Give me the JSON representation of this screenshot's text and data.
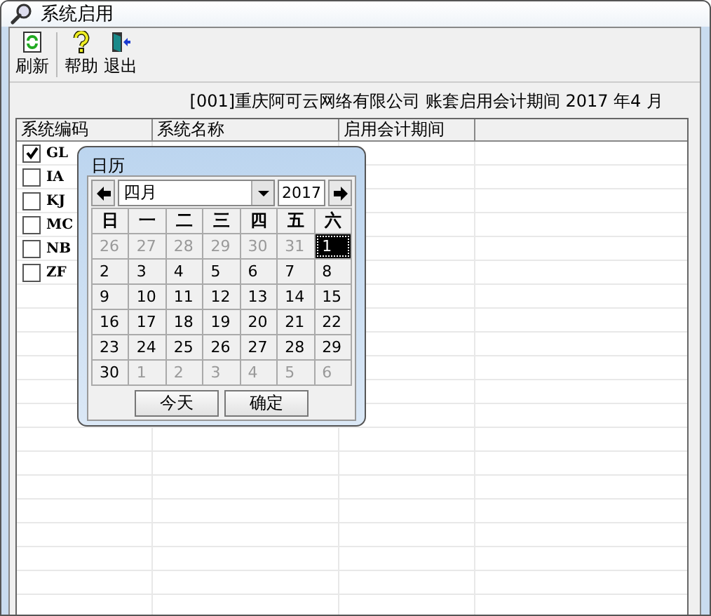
{
  "window": {
    "title": "系统启用"
  },
  "toolbar": [
    {
      "label": "刷新"
    },
    {
      "label": "帮助"
    },
    {
      "label": "退出"
    }
  ],
  "info": "[001]重庆阿可云网络有限公司 账套启用会计期间 2017 年4 月",
  "table": {
    "columns": [
      "系统编码",
      "系统名称",
      "启用会计期间"
    ],
    "rows": [
      {
        "code": "GL",
        "checked": true
      },
      {
        "code": "IA",
        "checked": false
      },
      {
        "code": "KJ",
        "checked": false
      },
      {
        "code": "MC",
        "checked": false
      },
      {
        "code": "NB",
        "checked": false
      },
      {
        "code": "ZF",
        "checked": false
      }
    ]
  },
  "calendar": {
    "title": "日历",
    "month": "四月",
    "year": "2017",
    "weekdays": [
      "日",
      "一",
      "二",
      "三",
      "四",
      "五",
      "六"
    ],
    "days": [
      {
        "label": "26",
        "current": false,
        "selected": false
      },
      {
        "label": "27",
        "current": false,
        "selected": false
      },
      {
        "label": "28",
        "current": false,
        "selected": false
      },
      {
        "label": "29",
        "current": false,
        "selected": false
      },
      {
        "label": "30",
        "current": false,
        "selected": false
      },
      {
        "label": "31",
        "current": false,
        "selected": false
      },
      {
        "label": "1",
        "current": true,
        "selected": true
      },
      {
        "label": "2",
        "current": true,
        "selected": false
      },
      {
        "label": "3",
        "current": true,
        "selected": false
      },
      {
        "label": "4",
        "current": true,
        "selected": false
      },
      {
        "label": "5",
        "current": true,
        "selected": false
      },
      {
        "label": "6",
        "current": true,
        "selected": false
      },
      {
        "label": "7",
        "current": true,
        "selected": false
      },
      {
        "label": "8",
        "current": true,
        "selected": false
      },
      {
        "label": "9",
        "current": true,
        "selected": false
      },
      {
        "label": "10",
        "current": true,
        "selected": false
      },
      {
        "label": "11",
        "current": true,
        "selected": false
      },
      {
        "label": "12",
        "current": true,
        "selected": false
      },
      {
        "label": "13",
        "current": true,
        "selected": false
      },
      {
        "label": "14",
        "current": true,
        "selected": false
      },
      {
        "label": "15",
        "current": true,
        "selected": false
      },
      {
        "label": "16",
        "current": true,
        "selected": false
      },
      {
        "label": "17",
        "current": true,
        "selected": false
      },
      {
        "label": "18",
        "current": true,
        "selected": false
      },
      {
        "label": "19",
        "current": true,
        "selected": false
      },
      {
        "label": "20",
        "current": true,
        "selected": false
      },
      {
        "label": "21",
        "current": true,
        "selected": false
      },
      {
        "label": "22",
        "current": true,
        "selected": false
      },
      {
        "label": "23",
        "current": true,
        "selected": false
      },
      {
        "label": "24",
        "current": true,
        "selected": false
      },
      {
        "label": "25",
        "current": true,
        "selected": false
      },
      {
        "label": "26",
        "current": true,
        "selected": false
      },
      {
        "label": "27",
        "current": true,
        "selected": false
      },
      {
        "label": "28",
        "current": true,
        "selected": false
      },
      {
        "label": "29",
        "current": true,
        "selected": false
      },
      {
        "label": "30",
        "current": true,
        "selected": false
      },
      {
        "label": "1",
        "current": false,
        "selected": false
      },
      {
        "label": "2",
        "current": false,
        "selected": false
      },
      {
        "label": "3",
        "current": false,
        "selected": false
      },
      {
        "label": "4",
        "current": false,
        "selected": false
      },
      {
        "label": "5",
        "current": false,
        "selected": false
      },
      {
        "label": "6",
        "current": false,
        "selected": false
      }
    ],
    "buttons": [
      "今天",
      "确定"
    ]
  }
}
